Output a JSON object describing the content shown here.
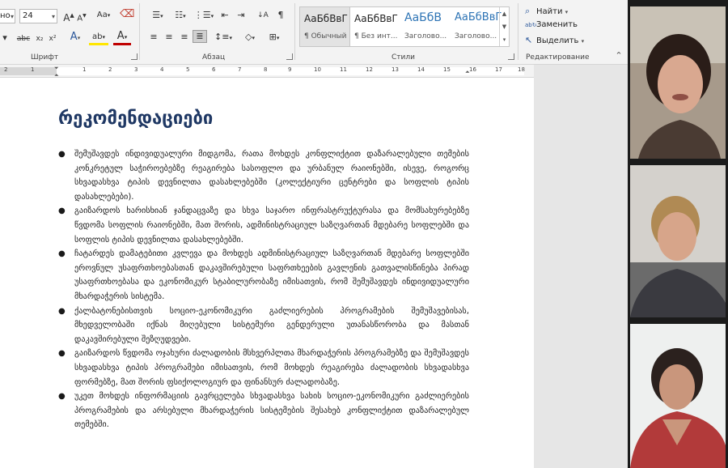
{
  "ribbon": {
    "font_group": {
      "label": "Шрифт",
      "font_name": "но",
      "font_size": "24",
      "grow_icon": "A",
      "shrink_icon": "A",
      "case_label": "Aa",
      "strikethrough": "abc",
      "subscript": "x₂",
      "superscript": "x²",
      "text_effects": "A",
      "highlight": "ab",
      "font_color": "A"
    },
    "paragraph_group": {
      "label": "Абзац",
      "sort_icon": "↓A",
      "pilcrow": "¶"
    },
    "styles_group": {
      "label": "Стили",
      "items": [
        {
          "preview": "АаБбВвГ",
          "name": "¶ Обычный"
        },
        {
          "preview": "АаБбВвГ",
          "name": "¶ Без инт..."
        },
        {
          "preview": "АаБбВ",
          "name": "Заголово..."
        },
        {
          "preview": "АаБбВвГ",
          "name": "Заголово..."
        }
      ]
    },
    "editing_group": {
      "label": "Редактирование",
      "find": "Найти",
      "replace": "Заменить",
      "select": "Выделить"
    }
  },
  "ruler": {
    "numbers": [
      "2",
      "1",
      "1",
      "2",
      "3",
      "4",
      "5",
      "6",
      "7",
      "8",
      "9",
      "10",
      "11",
      "12",
      "13",
      "14",
      "15",
      "16",
      "17",
      "18"
    ]
  },
  "document": {
    "title": "რეკომენდაციები",
    "bullets": [
      "შემუშავდეს ინდივიდუალური მიდგომა, რათა მოხდეს კონფლიქტით დაზარალებული თემების კონკრეტულ საჭიროებებზე რეაგირება სასოფლო და ურბანულ რაიონებში, ისევე, როგორც სხვადასხვა ტიპის დევნილთა დასახლებებში (კოლექტიური ცენტრები და სოფლის ტიპის დასახლებები).",
      "გაიზარდოს ხარისხიან ჯანდაცვაზე და სხვა საჯარო ინფრასტრუქტურასა და მომსახურებებზე წვდომა სოფლის რაიონებში, მათ შორის, ადმინისტრაციულ საზღვართან მდებარე სოფლებში და სოფლის ტიპის დევნილთა დასახლებებში.",
      "ჩატარდეს დამატებითი კვლევა და მოხდეს ადმინისტრაციულ საზღვართან მდებარე სოფლებში ეროვნულ უსაფრთხოებასთან დაკავშირებული საფრთხეების გავლენის გათვალისწინება პირად უსაფრთხოებასა და ეკონომიკურ სტაბილურობაზე იმისათვის, რომ შემუშავდეს ინდივიდუალური მხარდაჭერის სისტემა.",
      "ქალბატონებისთვის სოციო-ეკონომიკური გაძლიერების პროგრამების შემუშავებისას, მხედველობაში იქნას მიღებული სისტემური გენდერული უთანასწორობა და მასთან დაკავშირებული შეზღუდვები.",
      "გაიზარდოს წვდომა ოჯახური ძალადობის მსხვერპლთა მხარდაჭერის პროგრამებზე და შემუშავდეს სხვადასხვა ტიპის პროგრამები იმისათვის, რომ მოხდეს რეაგირება ძალადობის სხვადასხვა ფორმებზე, მათ შორის ფსიქოლოგიურ და ფინანსურ ძალადობაზე.",
      "უკეთ მოხდეს ინფორმაციის გავრცელება სხვადასხვა სახის სოციო-ეკონომიკური გაძლიერების პროგრამების და არსებული მხარდაჭერის სისტემების შესახებ კონფლიქტით დაზარალებულ თემებში."
    ]
  },
  "video_participants": [
    {
      "id": "participant-1"
    },
    {
      "id": "participant-2"
    },
    {
      "id": "participant-3"
    }
  ]
}
